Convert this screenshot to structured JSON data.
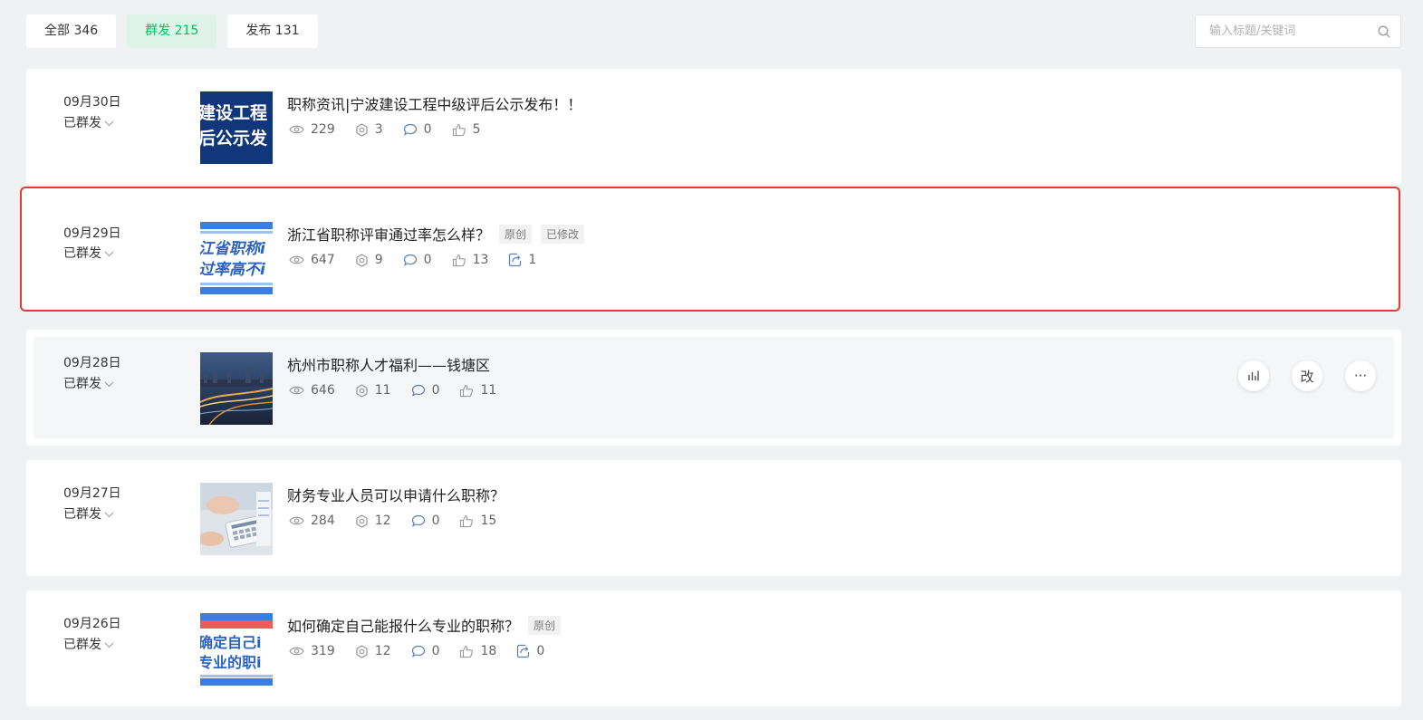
{
  "tabs": [
    {
      "label": "全部 346",
      "active": false
    },
    {
      "label": "群发 215",
      "active": true
    },
    {
      "label": "发布 131",
      "active": false
    }
  ],
  "search": {
    "placeholder": "输入标题/关键词",
    "icon": "search-icon"
  },
  "articles": [
    {
      "date": "09月30日",
      "status": "已群发",
      "title": "职称资讯|宁波建设工程中级评后公示发布！！",
      "tags": [],
      "thumb_text": [
        "建设工程",
        "后公示发"
      ],
      "views": "229",
      "shares": "3",
      "comments": "0",
      "likes": "5",
      "reposts": null
    },
    {
      "date": "09月29日",
      "status": "已群发",
      "title": "浙江省职称评审通过率怎么样？",
      "tags": [
        "原创",
        "已修改"
      ],
      "thumb_text": [
        "江省职称i",
        "过率高不i"
      ],
      "views": "647",
      "shares": "9",
      "comments": "0",
      "likes": "13",
      "reposts": "1"
    },
    {
      "date": "09月28日",
      "status": "已群发",
      "title": "杭州市职称人才福利——钱塘区",
      "tags": [],
      "thumb_text": [],
      "views": "646",
      "shares": "11",
      "comments": "0",
      "likes": "11",
      "reposts": null
    },
    {
      "date": "09月27日",
      "status": "已群发",
      "title": "财务专业人员可以申请什么职称？",
      "tags": [],
      "thumb_text": [],
      "views": "284",
      "shares": "12",
      "comments": "0",
      "likes": "15",
      "reposts": null
    },
    {
      "date": "09月26日",
      "status": "已群发",
      "title": "如何确定自己能报什么专业的职称？",
      "tags": [
        "原创"
      ],
      "thumb_text": [
        "确定自己i",
        "专业的职i"
      ],
      "views": "319",
      "shares": "12",
      "comments": "0",
      "likes": "18",
      "reposts": "0"
    }
  ],
  "hover_actions": {
    "stats_icon": "bar-chart-icon",
    "edit_label": "改",
    "more_label": "···"
  },
  "colors": {
    "accent": "#07c160",
    "selection": "#e53a32",
    "background": "#f0f1f3"
  }
}
